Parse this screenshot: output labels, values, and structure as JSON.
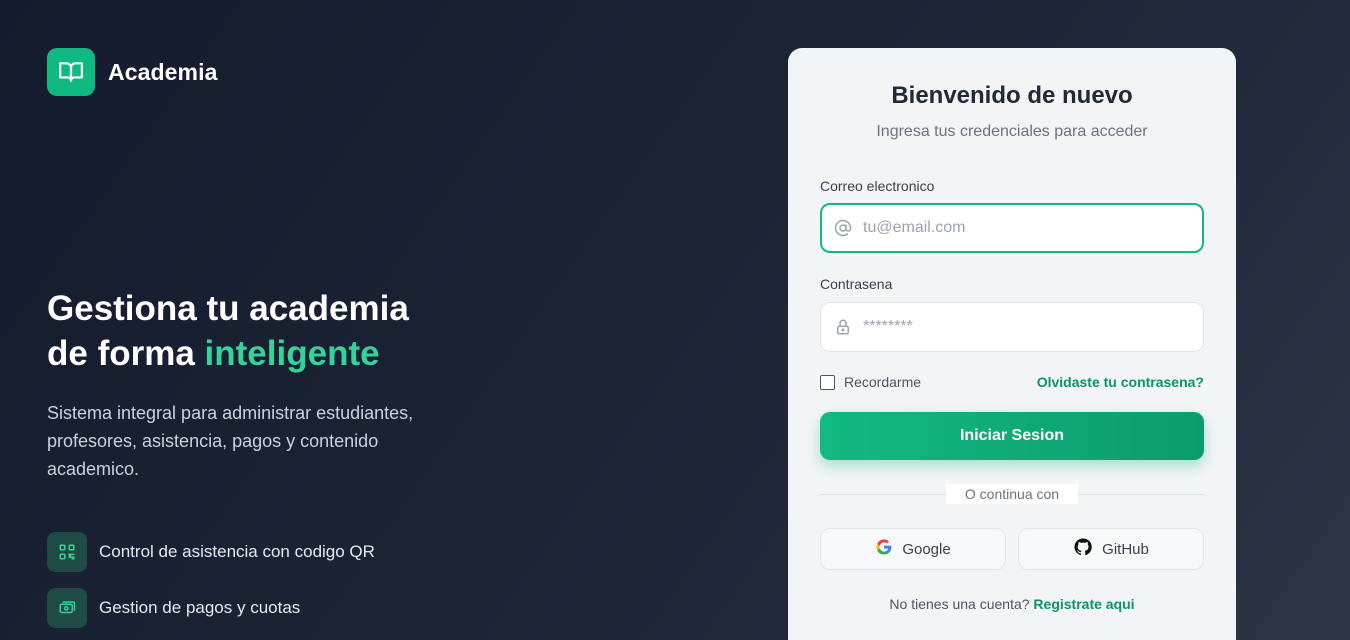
{
  "brand": {
    "name": "Academia",
    "logo_icon": "open-book-icon"
  },
  "hero": {
    "title_line1": "Gestiona tu academia",
    "title_line2_prefix": "de forma ",
    "title_line2_accent": "inteligente",
    "description": "Sistema integral para administrar estudiantes, profesores, asistencia, pagos y contenido academico."
  },
  "features": [
    {
      "icon": "qr-code-icon",
      "label": "Control de asistencia con codigo QR"
    },
    {
      "icon": "money-icon",
      "label": "Gestion de pagos y cuotas"
    }
  ],
  "login": {
    "title": "Bienvenido de nuevo",
    "subtitle": "Ingresa tus credenciales para acceder",
    "email": {
      "label": "Correo electronico",
      "placeholder": "tu@email.com",
      "value": ""
    },
    "password": {
      "label": "Contrasena",
      "placeholder": "********",
      "value": ""
    },
    "remember_label": "Recordarme",
    "remember_checked": false,
    "forgot_label": "Olvidaste tu contrasena?",
    "submit_label": "Iniciar Sesion",
    "divider_label": "O continua con",
    "google_label": "Google",
    "github_label": "GitHub",
    "signup_prompt": "No tienes una cuenta?",
    "signup_link": "Registrate aqui"
  },
  "colors": {
    "accent": "#10b981",
    "accent_dark": "#059669",
    "background": "#1b2335",
    "card": "#f3f4f6"
  }
}
